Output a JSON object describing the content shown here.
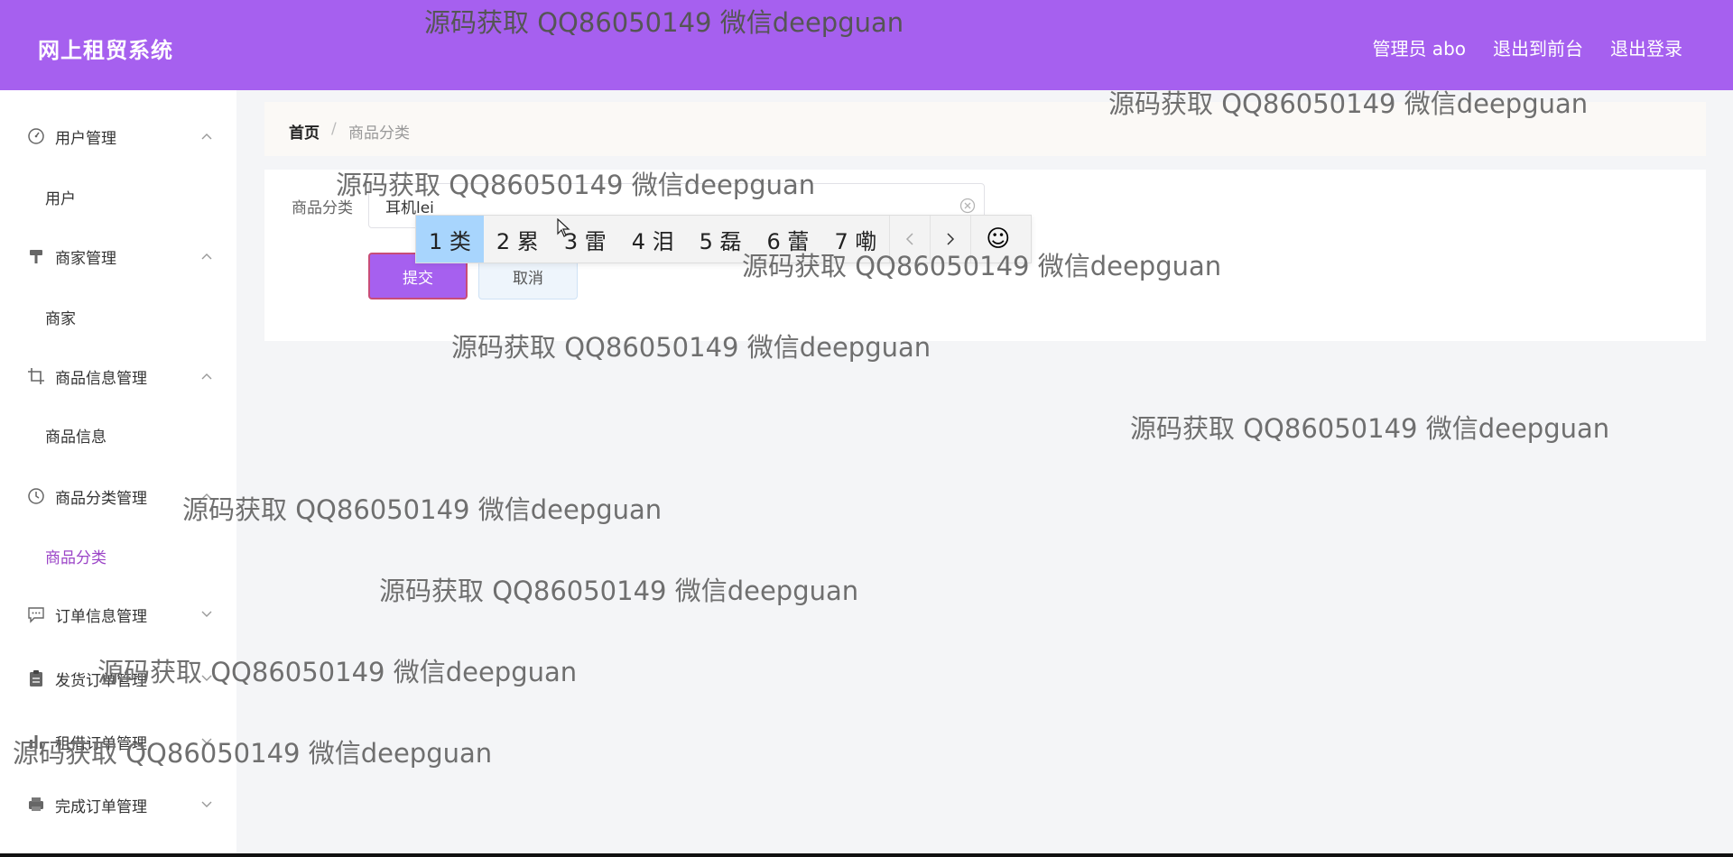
{
  "app": {
    "title": "网上租贸系统"
  },
  "header": {
    "links": [
      "管理员 abo",
      "退出到前台",
      "退出登录"
    ]
  },
  "sidebar": {
    "groups": [
      {
        "label": "用户管理",
        "icon": "dashboard-icon",
        "expanded": true,
        "sub": [
          "用户"
        ]
      },
      {
        "label": "商家管理",
        "icon": "brush-icon",
        "expanded": true,
        "sub": [
          "商家"
        ]
      },
      {
        "label": "商品信息管理",
        "icon": "crop-icon",
        "expanded": true,
        "sub": [
          "商品信息"
        ]
      },
      {
        "label": "商品分类管理",
        "icon": "clock-icon",
        "expanded": true,
        "sub": [
          "商品分类"
        ]
      },
      {
        "label": "订单信息管理",
        "icon": "chat-icon",
        "expanded": false,
        "sub": []
      },
      {
        "label": "发货订单管理",
        "icon": "clipboard-icon",
        "expanded": false,
        "sub": []
      },
      {
        "label": "租借订单管理",
        "icon": "bar-chart-icon",
        "expanded": false,
        "sub": []
      },
      {
        "label": "完成订单管理",
        "icon": "printer-icon",
        "expanded": false,
        "sub": []
      }
    ],
    "active_item": "商品分类"
  },
  "breadcrumb": {
    "home": "首页",
    "separator": "/",
    "current": "商品分类"
  },
  "form": {
    "label": "商品分类",
    "value": "耳机lei",
    "submit_label": "提交",
    "cancel_label": "取消"
  },
  "ime": {
    "candidates": [
      "1 类",
      "2 累",
      "3 雷",
      "4 泪",
      "5 磊",
      "6 蕾",
      "7 嘞"
    ],
    "selected_index": 0,
    "emoji": "☺"
  },
  "watermark": {
    "text": "源码获取 QQ86050149 微信deepguan"
  },
  "colors": {
    "accent": "#a660ef",
    "active_text": "#9b44c7",
    "ime_selected": "#a8d5fd"
  }
}
